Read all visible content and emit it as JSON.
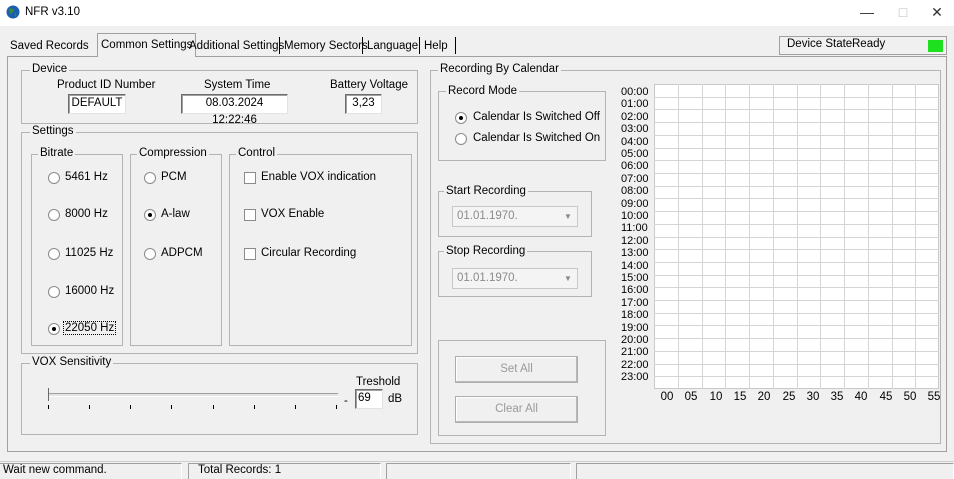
{
  "window": {
    "title": "NFR v3.10",
    "minimize": "—",
    "maximize": "□",
    "close": "✕"
  },
  "tabs": [
    {
      "label": "Saved Records"
    },
    {
      "label": "Common Settings",
      "active": true
    },
    {
      "label": "Additional Settings"
    },
    {
      "label": "Memory Sectors"
    },
    {
      "label": "Language"
    },
    {
      "label": "Help"
    }
  ],
  "device_state": {
    "label": "Device State",
    "value": "Ready",
    "indicator_color": "#1ee01e"
  },
  "device": {
    "title": "Device",
    "product_id_label": "Product ID Number",
    "product_id_value": "DEFAULT",
    "system_time_label": "System Time",
    "system_time_value": "08.03.2024 12:22:46",
    "battery_label": "Battery Voltage",
    "battery_value": "3,23"
  },
  "settings": {
    "title": "Settings",
    "bitrate": {
      "title": "Bitrate",
      "options": [
        "5461 Hz",
        "8000 Hz",
        "11025 Hz",
        "16000 Hz",
        "22050 Hz"
      ],
      "selected": "22050 Hz"
    },
    "compression": {
      "title": "Compression",
      "options": [
        "PCM",
        "A-law",
        "ADPCM"
      ],
      "selected": "A-law"
    },
    "control": {
      "title": "Control",
      "enable_vox": "Enable VOX indication",
      "vox_enable": "VOX Enable",
      "circular": "Circular Recording"
    }
  },
  "vox": {
    "title": "VOX Sensitivity",
    "threshold_label": "Treshold",
    "threshold_value": "69",
    "unit": "dB",
    "dash": "-",
    "slider_level": 0
  },
  "calendar": {
    "title": "Recording By Calendar",
    "record_mode_title": "Record Mode",
    "mode_off": "Calendar Is Switched Off",
    "mode_on": "Calendar Is Switched On",
    "mode_selected": "off",
    "start_title": "Start Recording",
    "start_value": "01.01.1970.",
    "stop_title": "Stop Recording",
    "stop_value": "01.01.1970.",
    "set_all": "Set All",
    "clear_all": "Clear All",
    "hours": [
      "00:00",
      "01:00",
      "02:00",
      "03:00",
      "04:00",
      "05:00",
      "06:00",
      "07:00",
      "08:00",
      "09:00",
      "10:00",
      "11:00",
      "12:00",
      "13:00",
      "14:00",
      "15:00",
      "16:00",
      "17:00",
      "18:00",
      "19:00",
      "20:00",
      "21:00",
      "22:00",
      "23:00"
    ],
    "minutes": [
      "00",
      "05",
      "10",
      "15",
      "20",
      "25",
      "30",
      "35",
      "40",
      "45",
      "50",
      "55"
    ]
  },
  "status": {
    "message": "Wait new command.",
    "total_records": "Total Records: 1"
  }
}
